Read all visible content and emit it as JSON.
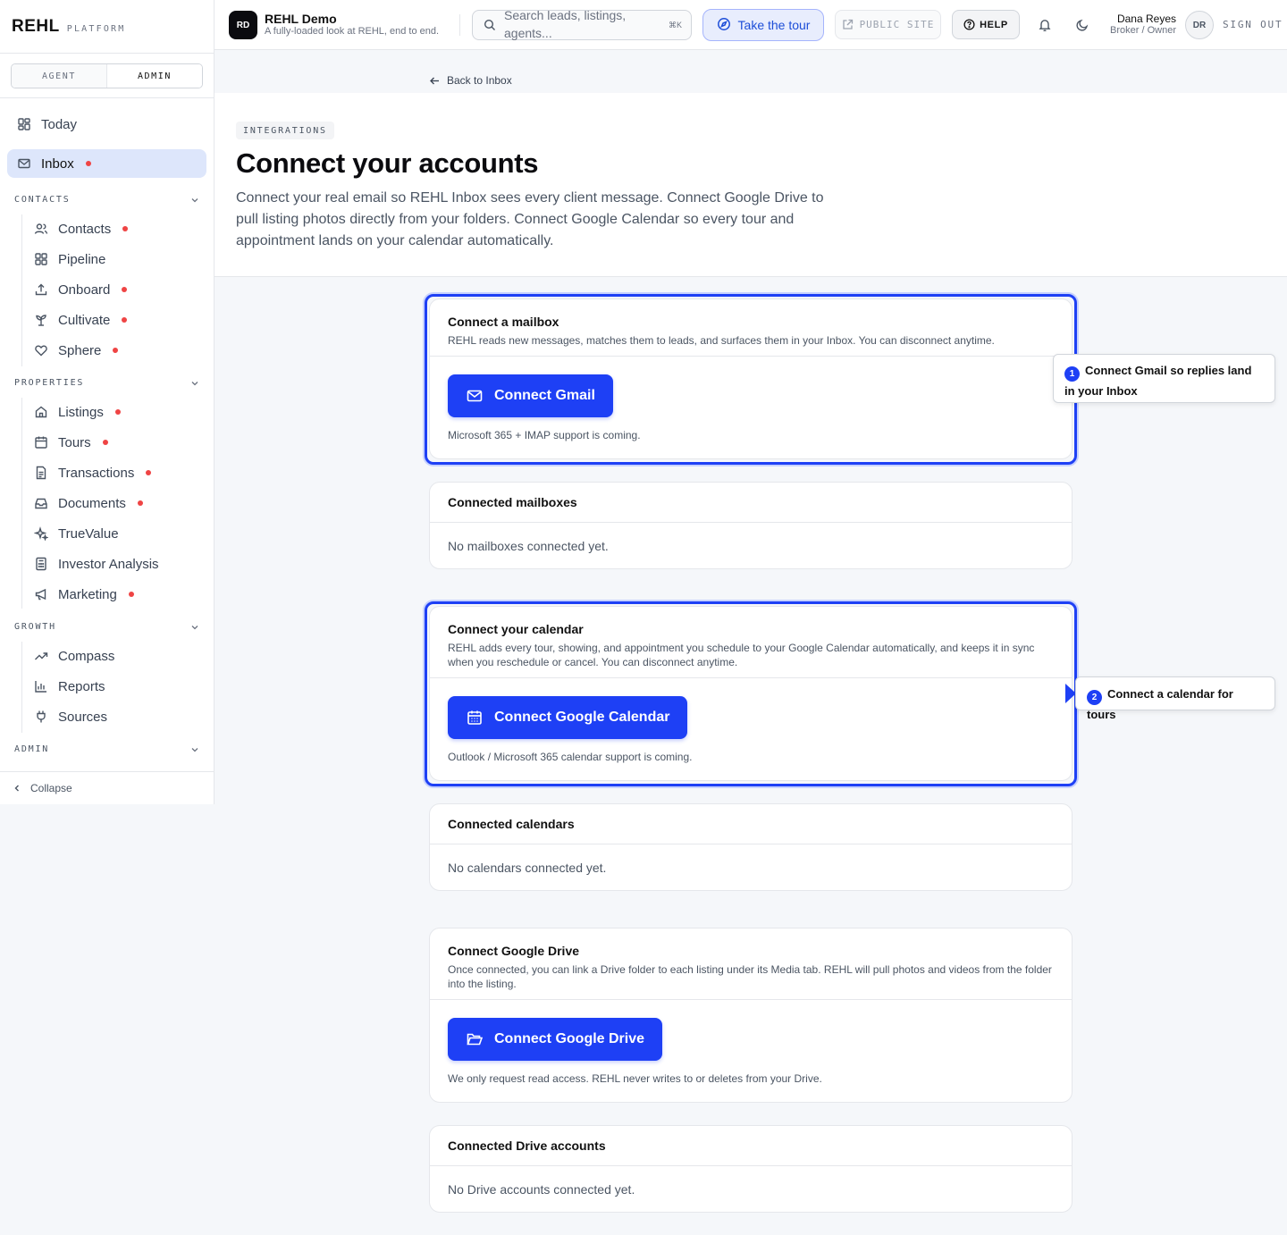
{
  "brand": {
    "name": "REHL",
    "sub": "PLATFORM"
  },
  "mode": {
    "agent": "AGENT",
    "admin": "ADMIN"
  },
  "nav": {
    "today": "Today",
    "inbox": "Inbox",
    "contacts_section": "CONTACTS",
    "contacts": "Contacts",
    "pipeline": "Pipeline",
    "onboard": "Onboard",
    "cultivate": "Cultivate",
    "sphere": "Sphere",
    "properties_section": "PROPERTIES",
    "listings": "Listings",
    "tours": "Tours",
    "transactions": "Transactions",
    "documents": "Documents",
    "truevalue": "TrueValue",
    "investor": "Investor Analysis",
    "marketing": "Marketing",
    "growth_section": "GROWTH",
    "compass": "Compass",
    "reports": "Reports",
    "sources": "Sources",
    "admin_section": "ADMIN",
    "collapse": "Collapse"
  },
  "topbar": {
    "ws_badge": "RD",
    "ws_name": "REHL Demo",
    "ws_sub": "A fully-loaded look at REHL, end to end.",
    "search_placeholder": "Search leads, listings, agents...",
    "search_kbd": "⌘K",
    "tour": "Take the tour",
    "public_site": "PUBLIC SITE",
    "help": "HELP",
    "user_name": "Dana Reyes",
    "user_role": "Broker / Owner",
    "avatar": "DR",
    "sign_out": "SIGN OUT"
  },
  "page": {
    "back": "Back to Inbox",
    "eyebrow": "INTEGRATIONS",
    "title": "Connect your accounts",
    "desc": "Connect your real email so REHL Inbox sees every client message. Connect Google Drive to pull listing photos directly from your folders. Connect Google Calendar so every tour and appointment lands on your calendar automatically."
  },
  "mailbox": {
    "title": "Connect a mailbox",
    "sub": "REHL reads new messages, matches them to leads, and surfaces them in your Inbox. You can disconnect anytime.",
    "button": "Connect Gmail",
    "note": "Microsoft 365 + IMAP support is coming."
  },
  "connected_mailboxes": {
    "title": "Connected mailboxes",
    "empty": "No mailboxes connected yet."
  },
  "calendar": {
    "title": "Connect your calendar",
    "sub": "REHL adds every tour, showing, and appointment you schedule to your Google Calendar automatically, and keeps it in sync when you reschedule or cancel. You can disconnect anytime.",
    "button": "Connect Google Calendar",
    "note": "Outlook / Microsoft 365 calendar support is coming."
  },
  "connected_calendars": {
    "title": "Connected calendars",
    "empty": "No calendars connected yet."
  },
  "drive": {
    "title": "Connect Google Drive",
    "sub": "Once connected, you can link a Drive folder to each listing under its Media tab. REHL will pull photos and videos from the folder into the listing.",
    "button": "Connect Google Drive",
    "note": "We only request read access. REHL never writes to or deletes from your Drive."
  },
  "connected_drive": {
    "title": "Connected Drive accounts",
    "empty": "No Drive accounts connected yet."
  },
  "tour_tips": [
    {
      "num": "1",
      "text": "Connect Gmail so replies land in your Inbox"
    },
    {
      "num": "2",
      "text": "Connect a calendar for tours"
    }
  ],
  "colors": {
    "accent": "#1e40f5",
    "alert_dot": "#ef4444",
    "nav_active": "#dde6fb"
  }
}
